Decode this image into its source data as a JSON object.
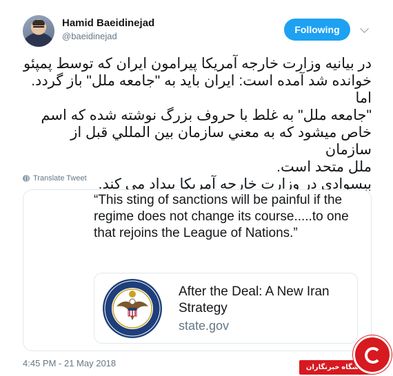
{
  "author": {
    "name": "Hamid Baeidinejad",
    "handle": "@baeidinejad"
  },
  "follow_button": {
    "label": "Following"
  },
  "tweet": {
    "text": "در بيانيه وزارت خارجه آمريكا پيرامون ايران كه توسط پمپئو\nخوانده شد آمده است: ايران بايد به \"جامعه ملل\" باز گردد. اما\n\"جامعه ملل\" به غلط با حروف بزرگ نوشته شده كه اسم\nخاص ميشود كه به معني سازمان بين المللي قبل از سازمان\nملل متحد است.\nبيسوادي در وزارت خارجه آمريكا بيداد مي كند.",
    "translate_label": "Translate Tweet",
    "timestamp": "4:45 PM - 21 May 2018"
  },
  "quoted_card": {
    "quote": "“This sting of sanctions will be painful if the regime does not change its course.....to one that rejoins the League of Nations.”",
    "link": {
      "title": "After the Deal: A New Iran Strategy",
      "domain": "state.gov",
      "image": "us-department-of-state-seal"
    }
  },
  "watermark": {
    "text": "باشگاه خبرنگاران",
    "color": "#d71920"
  },
  "colors": {
    "accent": "#1da1f2",
    "text": "#14171a",
    "secondary_text": "#657786",
    "border": "#e1e8ed"
  }
}
